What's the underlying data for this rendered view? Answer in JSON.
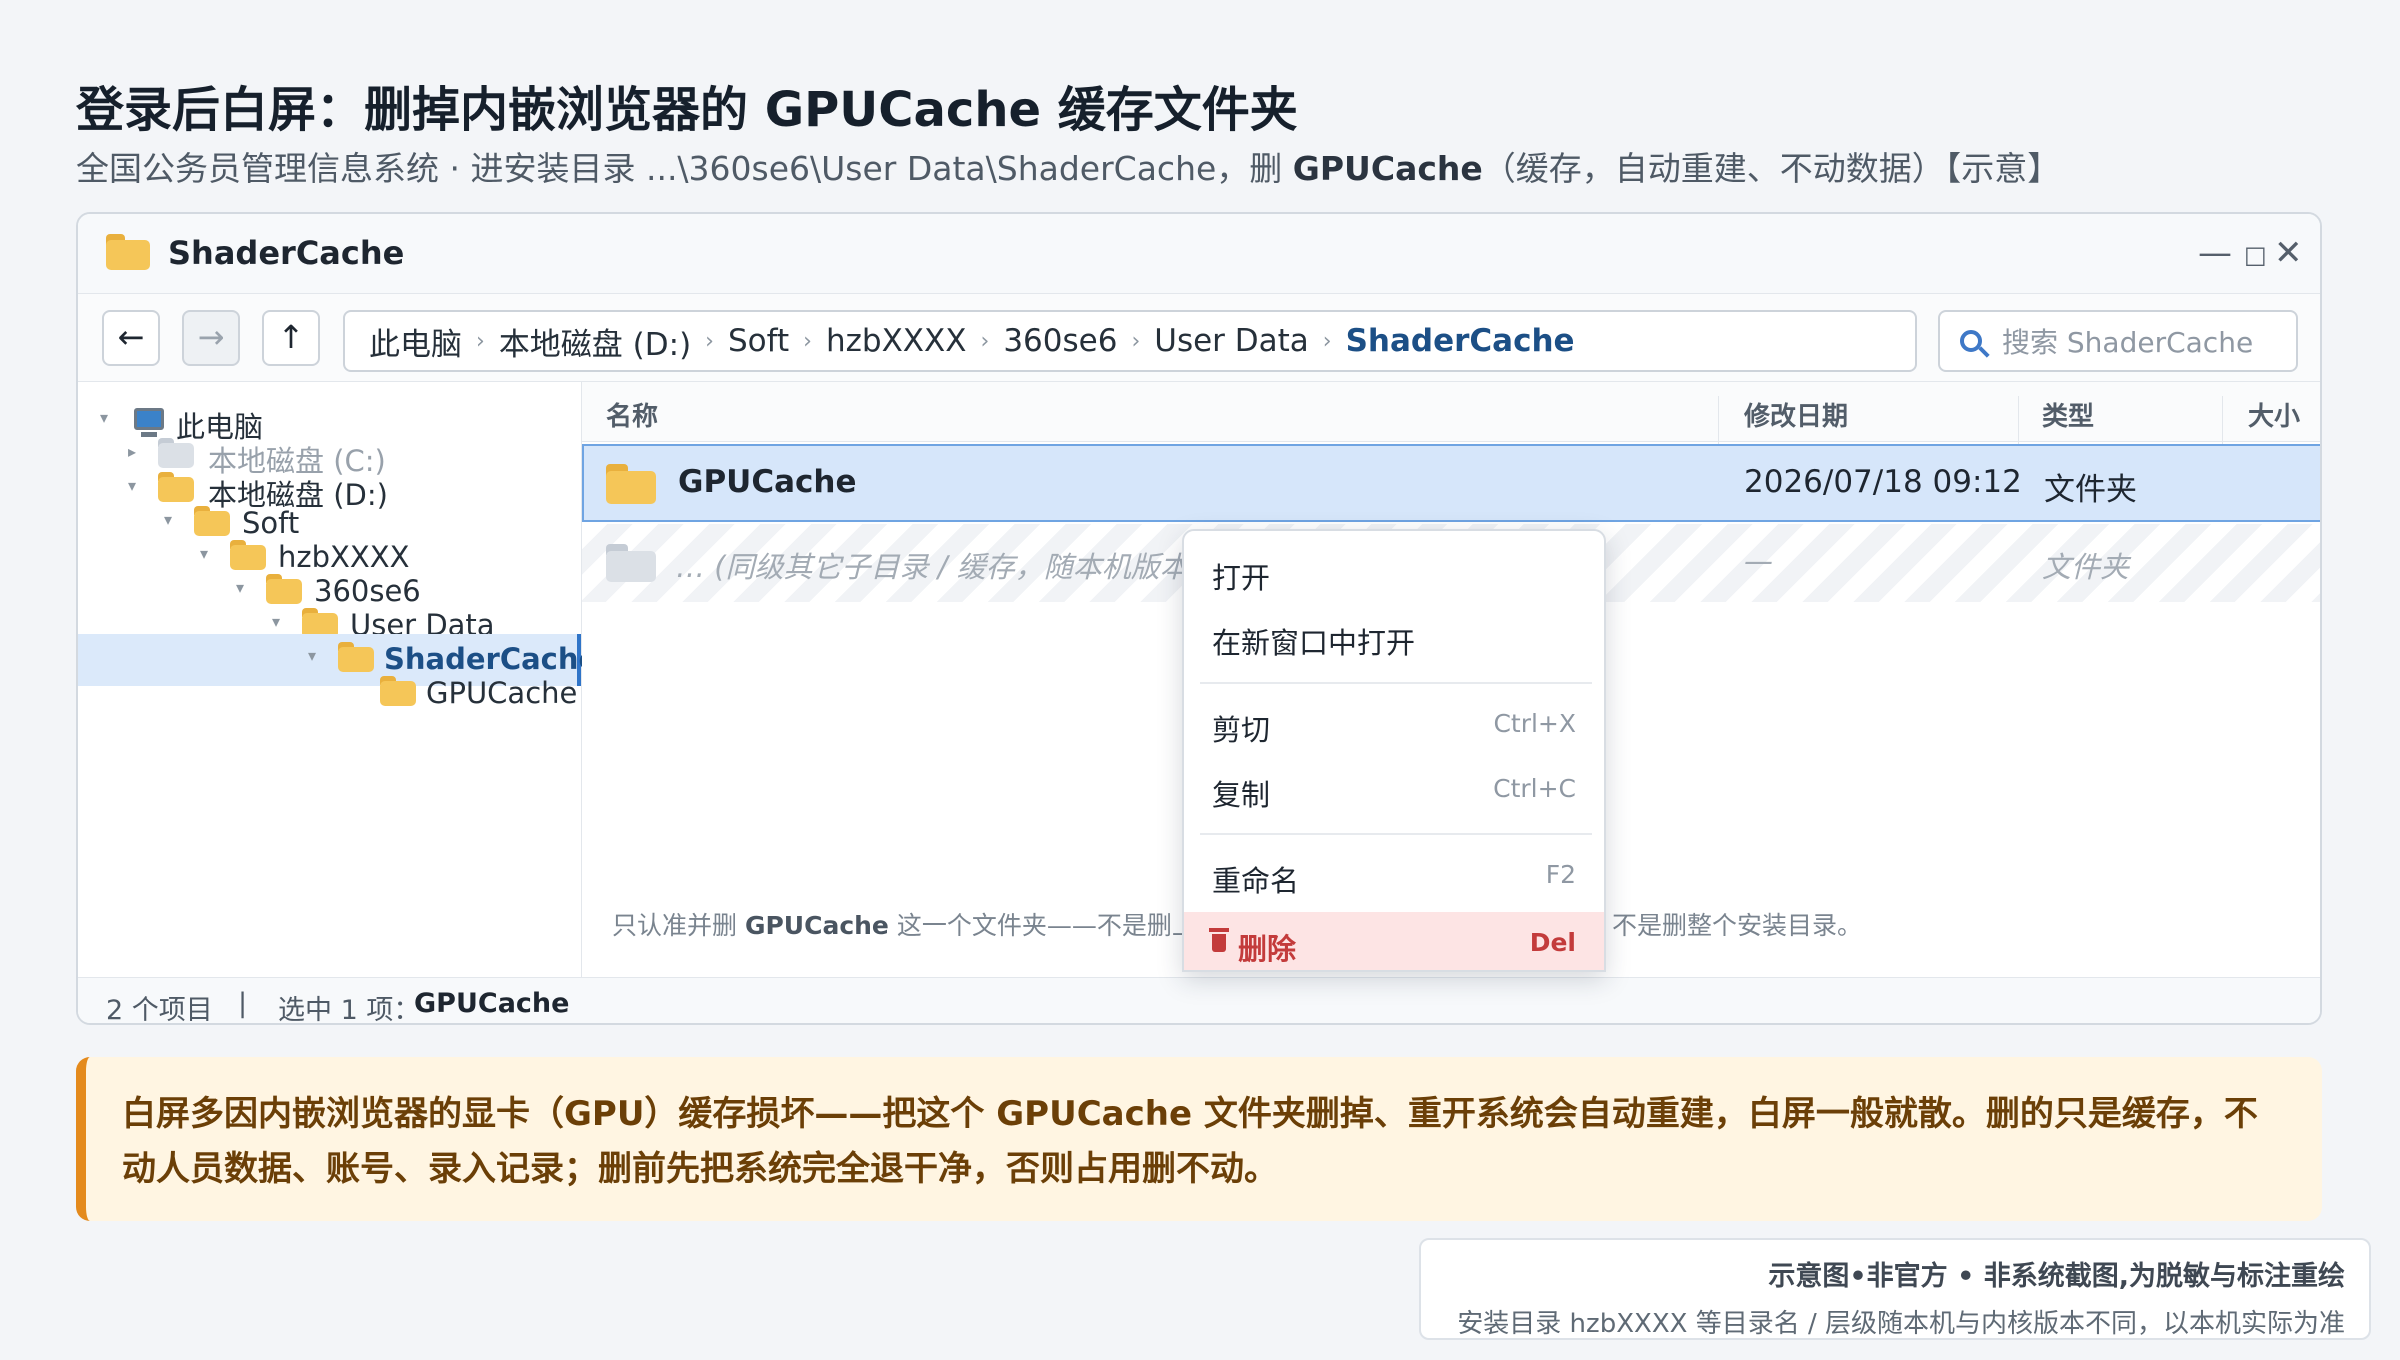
{
  "page": {
    "title": "登录后白屏：删掉内嵌浏览器的 GPUCache 缓存文件夹",
    "subtitle_pre": "全国公务员管理信息系统 · 进安装目录 ...\\360se6\\User Data\\ShaderCache，删 ",
    "subtitle_bold": "GPUCache",
    "subtitle_post": "（缓存，自动重建、不动数据）【示意】"
  },
  "window": {
    "title": "ShaderCache",
    "controls": {
      "minimize": "—",
      "maximize": "□",
      "close": "✕"
    }
  },
  "toolbar": {
    "back": "←",
    "forward": "→",
    "up": "↑",
    "address": [
      "此电脑",
      "本地磁盘 (D:)",
      "Soft",
      "hzbXXXX",
      "360se6",
      "User Data",
      "ShaderCache"
    ],
    "separator": "›",
    "search_placeholder": "搜索 ShaderCache"
  },
  "tree": [
    {
      "label": "此电脑",
      "arrow": "▾"
    },
    {
      "label": "本地磁盘 (C:)",
      "arrow": "▸"
    },
    {
      "label": "本地磁盘 (D:)",
      "arrow": "▾"
    },
    {
      "label": "Soft",
      "arrow": "▾"
    },
    {
      "label": "hzbXXXX",
      "arrow": "▾"
    },
    {
      "label": "360se6",
      "arrow": "▾"
    },
    {
      "label": "User Data",
      "arrow": "▾"
    },
    {
      "label": "ShaderCache",
      "arrow": "▾",
      "selected": true
    },
    {
      "label": "GPUCache",
      "arrow": ""
    }
  ],
  "columns": [
    "名称",
    "修改日期",
    "类型",
    "大小"
  ],
  "rows": [
    {
      "name": "GPUCache",
      "date": "2026/07/18 09:12",
      "type": "文件夹",
      "size": ""
    },
    {
      "name": "… (同级其它子目录 / 缓存，随本机版本",
      "date": "—",
      "type": "文件夹",
      "size": ""
    }
  ],
  "pane_note": {
    "pre": "只认准并删 ",
    "bold": "GPUCache",
    "mid": " 这一个文件夹——不是删上",
    "post": "不是删整个安装目录。"
  },
  "status": {
    "count": "2 个项目",
    "divider": "|",
    "selection_label": "选中 1 项：",
    "selection_name": "GPUCache"
  },
  "context_menu": [
    {
      "label": "打开",
      "shortcut": ""
    },
    {
      "label": "在新窗口中打开",
      "shortcut": ""
    },
    {
      "label": "剪切",
      "shortcut": "Ctrl+X"
    },
    {
      "label": "复制",
      "shortcut": "Ctrl+C"
    },
    {
      "label": "重命名",
      "shortcut": "F2"
    },
    {
      "label": "删除",
      "shortcut": "Del",
      "danger": true
    }
  ],
  "callout": "白屏多因内嵌浏览器的显卡（GPU）缓存损坏——把这个 GPUCache 文件夹删掉、重开系统会自动重建，白屏一般就散。删的只是缓存，不动人员数据、账号、录入记录；删前先把系统完全退干净，否则占用删不动。",
  "disclaimer": {
    "line1": "示意图•非官方 • 非系统截图,为脱敏与标注重绘",
    "line2": "安装目录 hzbXXXX 等目录名 / 层级随本机与内核版本不同，以本机实际为准"
  },
  "colors": {
    "accent": "#2f74c8",
    "selection": "#d6e6fa",
    "folder": "#f5c658",
    "danger": "#c33b3b",
    "callout_bg": "#fff5e2",
    "callout_border": "#e48a1c"
  },
  "icons": [
    "folder-icon",
    "computer-icon",
    "search-icon",
    "trash-icon"
  ]
}
